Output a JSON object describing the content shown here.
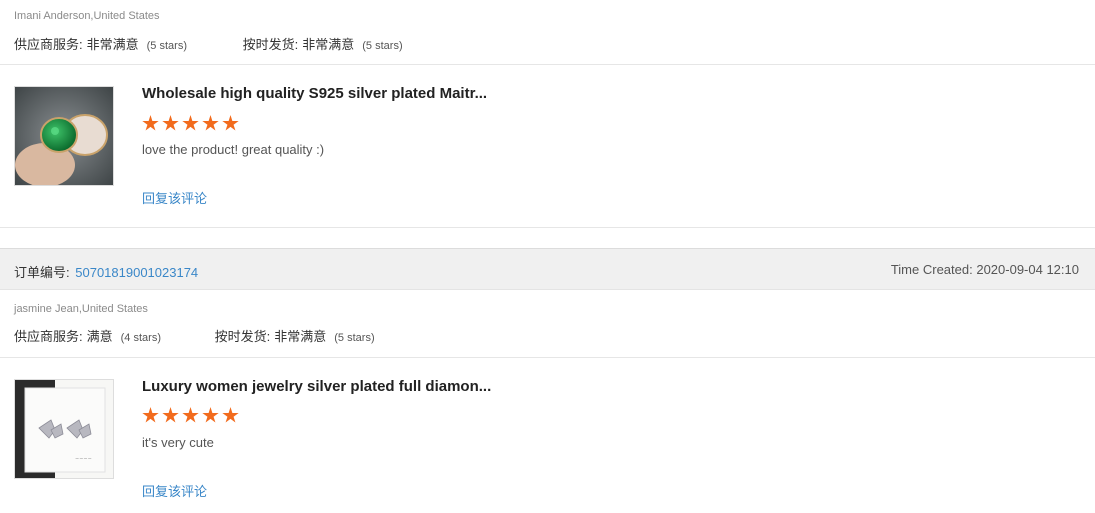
{
  "reviews": [
    {
      "buyer": "Imani Anderson,United States",
      "service_label": "供应商服务:",
      "service_value": "非常满意",
      "service_stars": "(5 stars)",
      "shipping_label": "按时发货:",
      "shipping_value": "非常满意",
      "shipping_stars": "(5 stars)",
      "product_title": "Wholesale high quality S925 silver plated Maitr...",
      "rating": 5,
      "text": "love the product!  great quality :)",
      "reply_label": "回复该评论"
    },
    {
      "buyer": "jasmine Jean,United States",
      "service_label": "供应商服务:",
      "service_value": "满意",
      "service_stars": "(4 stars)",
      "shipping_label": "按时发货:",
      "shipping_value": "非常满意",
      "shipping_stars": "(5 stars)",
      "product_title": "Luxury women jewelry silver plated full diamon...",
      "rating": 5,
      "text": "it's very cute",
      "reply_label": "回复该评论"
    }
  ],
  "order": {
    "label": "订单编号:",
    "number": "50701819001023174",
    "created_label": "Time Created:",
    "created_value": "2020-09-04 12:10"
  },
  "colors": {
    "star": "#f26b1d",
    "link": "#3a87c8"
  }
}
